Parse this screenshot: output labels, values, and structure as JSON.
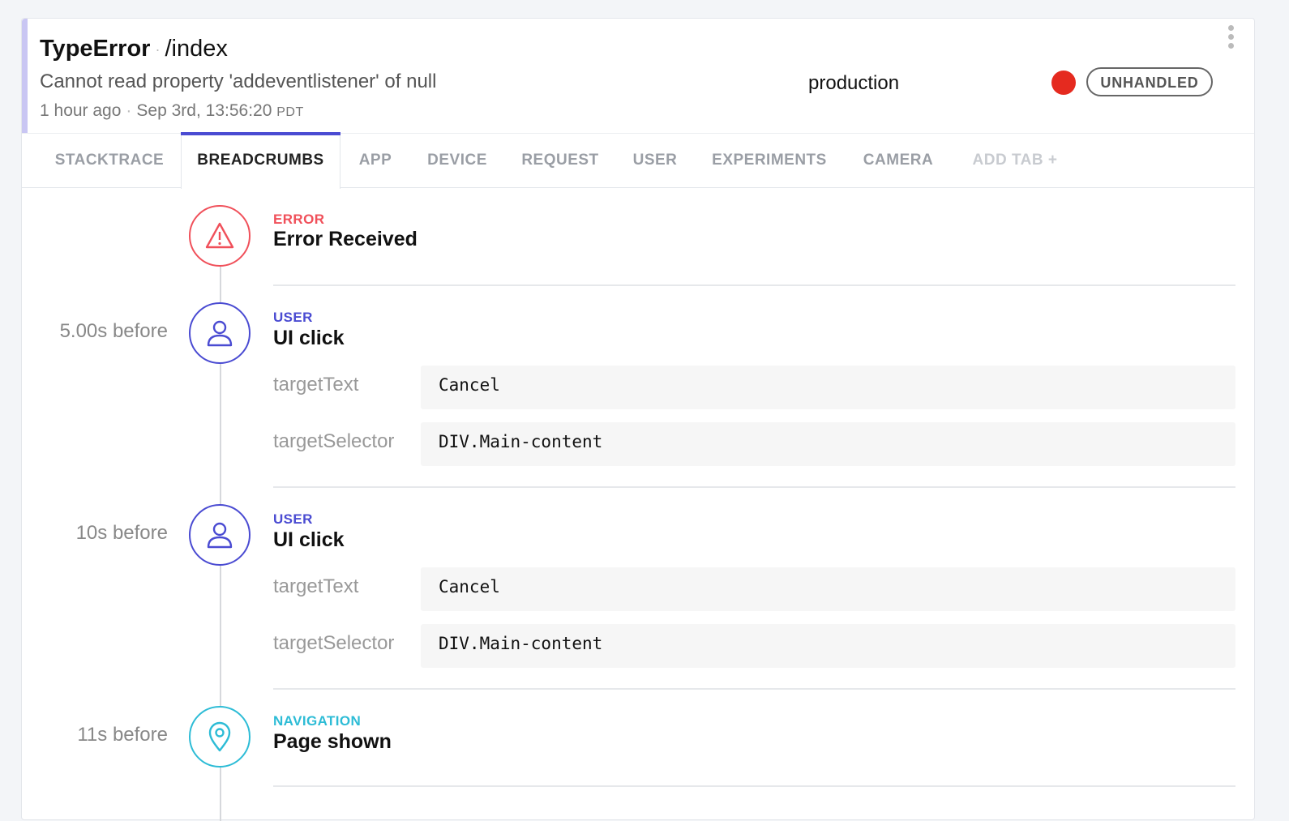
{
  "header": {
    "error_class": "TypeError",
    "separator": "·",
    "context": "/index",
    "message": "Cannot read property 'addeventlistener' of null",
    "relative_time": "1 hour ago",
    "time_separator": "·",
    "timestamp": "Sep 3rd, 13:56:20",
    "timezone": "PDT",
    "environment": "production",
    "status_color": "#e52a1f",
    "badge": "UNHANDLED"
  },
  "tabs": [
    {
      "label": "STACKTRACE",
      "active": false
    },
    {
      "label": "BREADCRUMBS",
      "active": true
    },
    {
      "label": "APP",
      "active": false
    },
    {
      "label": "DEVICE",
      "active": false
    },
    {
      "label": "REQUEST",
      "active": false
    },
    {
      "label": "USER",
      "active": false
    },
    {
      "label": "EXPERIMENTS",
      "active": false
    },
    {
      "label": "CAMERA",
      "active": false
    },
    {
      "label": "ADD TAB +",
      "active": false
    }
  ],
  "breadcrumbs": [
    {
      "time": "",
      "type": "ERROR",
      "name": "Error Received",
      "icon": "warning-icon"
    },
    {
      "time": "5.00s before",
      "type": "USER",
      "name": "UI click",
      "icon": "user-icon",
      "meta": [
        {
          "key": "targetText",
          "value": "Cancel"
        },
        {
          "key": "targetSelector",
          "value": "DIV.Main-content"
        }
      ]
    },
    {
      "time": "10s before",
      "type": "USER",
      "name": "UI click",
      "icon": "user-icon",
      "meta": [
        {
          "key": "targetText",
          "value": "Cancel"
        },
        {
          "key": "targetSelector",
          "value": "DIV.Main-content"
        }
      ]
    },
    {
      "time": "11s before",
      "type": "NAVIGATION",
      "name": "Page shown",
      "icon": "location-pin-icon"
    }
  ],
  "colors": {
    "accent": "#4a4bd2",
    "error": "#f0505a",
    "navigation": "#2dbcd6"
  }
}
